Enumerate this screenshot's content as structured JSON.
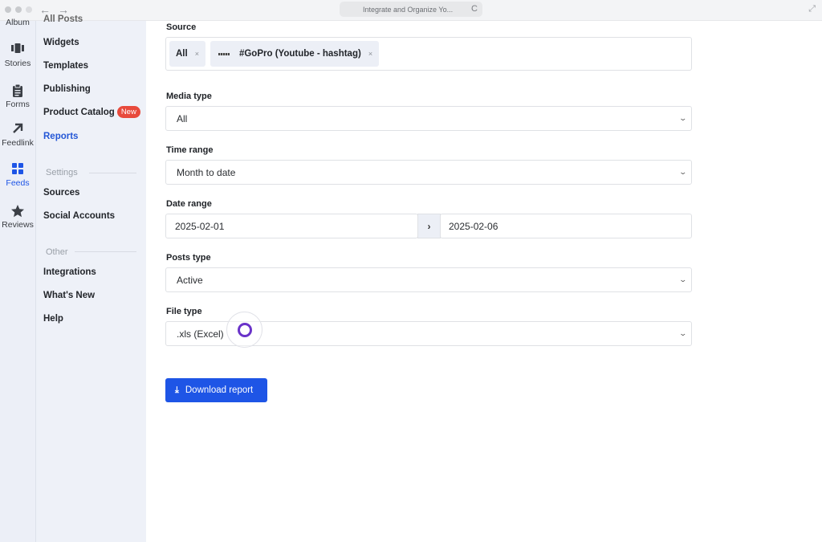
{
  "browser": {
    "url_title": "Integrate and Organize Yo...",
    "back_icon": "←",
    "forward_icon": "→",
    "reload_icon": "C",
    "expand_icon": "⤢"
  },
  "rail": {
    "items": [
      {
        "label": "Album",
        "icon": "album-icon"
      },
      {
        "label": "Stories",
        "icon": "stories-icon"
      },
      {
        "label": "Forms",
        "icon": "clipboard-icon"
      },
      {
        "label": "Feedlink",
        "icon": "arrow-up-right-icon"
      },
      {
        "label": "Feeds",
        "icon": "grid-icon",
        "active": true
      },
      {
        "label": "Reviews",
        "icon": "star-icon"
      }
    ]
  },
  "subnav": {
    "items": [
      {
        "label": "All Posts"
      },
      {
        "label": "Widgets"
      },
      {
        "label": "Templates"
      },
      {
        "label": "Publishing"
      },
      {
        "label": "Product Catalog",
        "badge": "New"
      },
      {
        "label": "Reports",
        "active": true
      }
    ],
    "settings": {
      "title": "Settings",
      "items": [
        {
          "label": "Sources"
        },
        {
          "label": "Social Accounts"
        }
      ]
    },
    "other": {
      "title": "Other",
      "items": [
        {
          "label": "Integrations"
        },
        {
          "label": "What's New"
        },
        {
          "label": "Help"
        }
      ]
    }
  },
  "form": {
    "source": {
      "label": "Source",
      "chips": [
        {
          "label": "All",
          "remove": "×"
        },
        {
          "label": "#GoPro (Youtube - hashtag)",
          "remove": "×"
        }
      ]
    },
    "media_type": {
      "label": "Media type",
      "value": "All"
    },
    "time_range": {
      "label": "Time range",
      "value": "Month to date"
    },
    "date_range": {
      "label": "Date range",
      "start": "2025-02-01",
      "separator": "›",
      "end": "2025-02-06"
    },
    "posts_type": {
      "label": "Posts type",
      "value": "Active"
    },
    "file_type": {
      "label": "File type",
      "value": ".xls (Excel)"
    },
    "chevron": "⌄",
    "download_button": {
      "label": "Download report",
      "icon": "⤓"
    }
  }
}
